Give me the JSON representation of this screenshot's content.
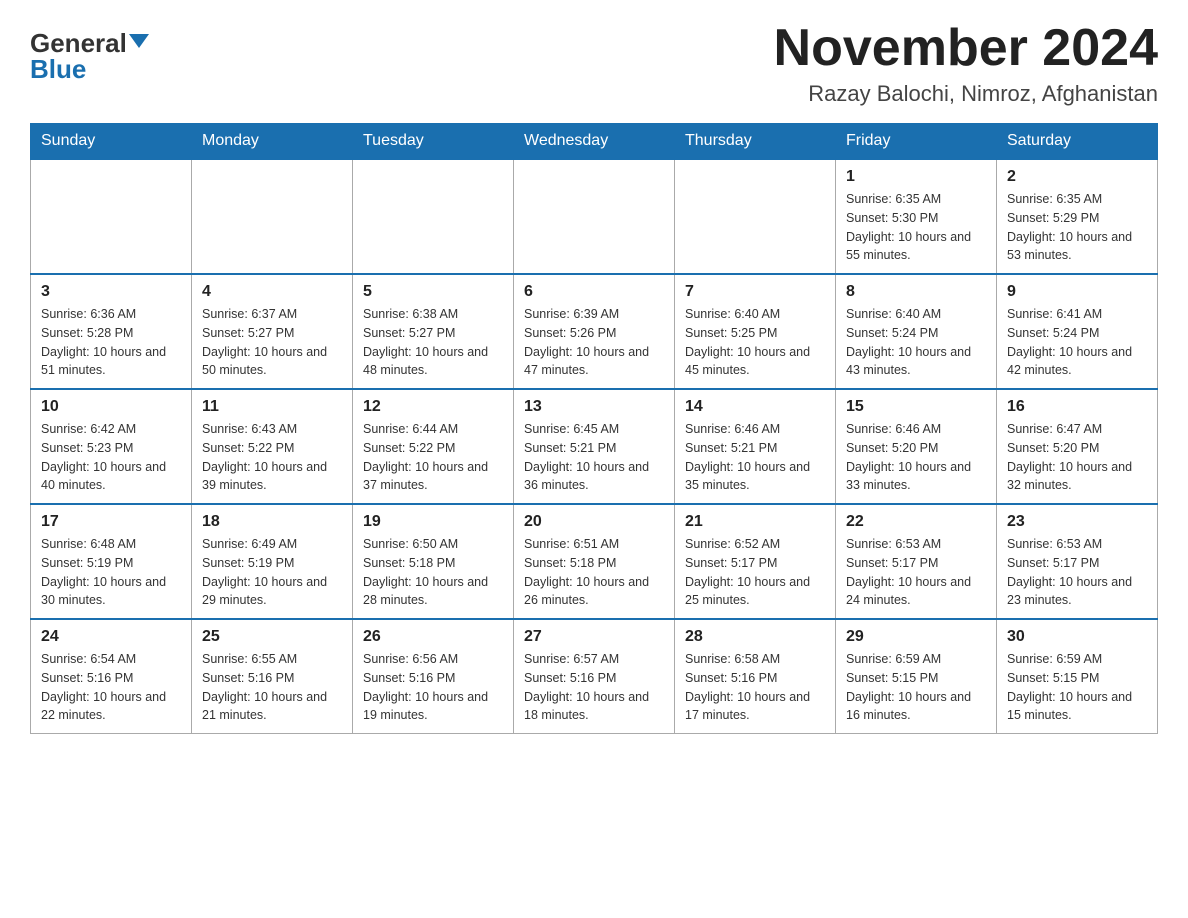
{
  "logo": {
    "general": "General",
    "blue": "Blue"
  },
  "title": "November 2024",
  "subtitle": "Razay Balochi, Nimroz, Afghanistan",
  "weekdays": [
    "Sunday",
    "Monday",
    "Tuesday",
    "Wednesday",
    "Thursday",
    "Friday",
    "Saturday"
  ],
  "rows": [
    [
      {
        "day": "",
        "info": ""
      },
      {
        "day": "",
        "info": ""
      },
      {
        "day": "",
        "info": ""
      },
      {
        "day": "",
        "info": ""
      },
      {
        "day": "",
        "info": ""
      },
      {
        "day": "1",
        "info": "Sunrise: 6:35 AM\nSunset: 5:30 PM\nDaylight: 10 hours and 55 minutes."
      },
      {
        "day": "2",
        "info": "Sunrise: 6:35 AM\nSunset: 5:29 PM\nDaylight: 10 hours and 53 minutes."
      }
    ],
    [
      {
        "day": "3",
        "info": "Sunrise: 6:36 AM\nSunset: 5:28 PM\nDaylight: 10 hours and 51 minutes."
      },
      {
        "day": "4",
        "info": "Sunrise: 6:37 AM\nSunset: 5:27 PM\nDaylight: 10 hours and 50 minutes."
      },
      {
        "day": "5",
        "info": "Sunrise: 6:38 AM\nSunset: 5:27 PM\nDaylight: 10 hours and 48 minutes."
      },
      {
        "day": "6",
        "info": "Sunrise: 6:39 AM\nSunset: 5:26 PM\nDaylight: 10 hours and 47 minutes."
      },
      {
        "day": "7",
        "info": "Sunrise: 6:40 AM\nSunset: 5:25 PM\nDaylight: 10 hours and 45 minutes."
      },
      {
        "day": "8",
        "info": "Sunrise: 6:40 AM\nSunset: 5:24 PM\nDaylight: 10 hours and 43 minutes."
      },
      {
        "day": "9",
        "info": "Sunrise: 6:41 AM\nSunset: 5:24 PM\nDaylight: 10 hours and 42 minutes."
      }
    ],
    [
      {
        "day": "10",
        "info": "Sunrise: 6:42 AM\nSunset: 5:23 PM\nDaylight: 10 hours and 40 minutes."
      },
      {
        "day": "11",
        "info": "Sunrise: 6:43 AM\nSunset: 5:22 PM\nDaylight: 10 hours and 39 minutes."
      },
      {
        "day": "12",
        "info": "Sunrise: 6:44 AM\nSunset: 5:22 PM\nDaylight: 10 hours and 37 minutes."
      },
      {
        "day": "13",
        "info": "Sunrise: 6:45 AM\nSunset: 5:21 PM\nDaylight: 10 hours and 36 minutes."
      },
      {
        "day": "14",
        "info": "Sunrise: 6:46 AM\nSunset: 5:21 PM\nDaylight: 10 hours and 35 minutes."
      },
      {
        "day": "15",
        "info": "Sunrise: 6:46 AM\nSunset: 5:20 PM\nDaylight: 10 hours and 33 minutes."
      },
      {
        "day": "16",
        "info": "Sunrise: 6:47 AM\nSunset: 5:20 PM\nDaylight: 10 hours and 32 minutes."
      }
    ],
    [
      {
        "day": "17",
        "info": "Sunrise: 6:48 AM\nSunset: 5:19 PM\nDaylight: 10 hours and 30 minutes."
      },
      {
        "day": "18",
        "info": "Sunrise: 6:49 AM\nSunset: 5:19 PM\nDaylight: 10 hours and 29 minutes."
      },
      {
        "day": "19",
        "info": "Sunrise: 6:50 AM\nSunset: 5:18 PM\nDaylight: 10 hours and 28 minutes."
      },
      {
        "day": "20",
        "info": "Sunrise: 6:51 AM\nSunset: 5:18 PM\nDaylight: 10 hours and 26 minutes."
      },
      {
        "day": "21",
        "info": "Sunrise: 6:52 AM\nSunset: 5:17 PM\nDaylight: 10 hours and 25 minutes."
      },
      {
        "day": "22",
        "info": "Sunrise: 6:53 AM\nSunset: 5:17 PM\nDaylight: 10 hours and 24 minutes."
      },
      {
        "day": "23",
        "info": "Sunrise: 6:53 AM\nSunset: 5:17 PM\nDaylight: 10 hours and 23 minutes."
      }
    ],
    [
      {
        "day": "24",
        "info": "Sunrise: 6:54 AM\nSunset: 5:16 PM\nDaylight: 10 hours and 22 minutes."
      },
      {
        "day": "25",
        "info": "Sunrise: 6:55 AM\nSunset: 5:16 PM\nDaylight: 10 hours and 21 minutes."
      },
      {
        "day": "26",
        "info": "Sunrise: 6:56 AM\nSunset: 5:16 PM\nDaylight: 10 hours and 19 minutes."
      },
      {
        "day": "27",
        "info": "Sunrise: 6:57 AM\nSunset: 5:16 PM\nDaylight: 10 hours and 18 minutes."
      },
      {
        "day": "28",
        "info": "Sunrise: 6:58 AM\nSunset: 5:16 PM\nDaylight: 10 hours and 17 minutes."
      },
      {
        "day": "29",
        "info": "Sunrise: 6:59 AM\nSunset: 5:15 PM\nDaylight: 10 hours and 16 minutes."
      },
      {
        "day": "30",
        "info": "Sunrise: 6:59 AM\nSunset: 5:15 PM\nDaylight: 10 hours and 15 minutes."
      }
    ]
  ]
}
